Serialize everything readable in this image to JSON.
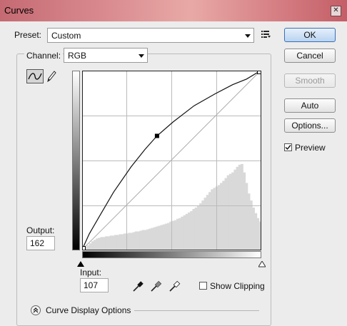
{
  "window": {
    "title": "Curves",
    "close_glyph": "✕"
  },
  "preset": {
    "label": "Preset:",
    "value": "Custom",
    "menu_icon": "preset-options-icon"
  },
  "channel": {
    "label": "Channel:",
    "value": "RGB"
  },
  "buttons": {
    "ok": "OK",
    "cancel": "Cancel",
    "smooth": "Smooth",
    "auto": "Auto",
    "options": "Options..."
  },
  "preview": {
    "label": "Preview",
    "checked": true
  },
  "tools": {
    "curve_tool": "curve-point-icon",
    "pencil_tool": "pencil-icon"
  },
  "output": {
    "label": "Output:",
    "value": "162"
  },
  "input": {
    "label": "Input:",
    "value": "107"
  },
  "eyedroppers": [
    "black-point-eyedropper-icon",
    "gray-point-eyedropper-icon",
    "white-point-eyedropper-icon"
  ],
  "show_clipping": {
    "label": "Show Clipping",
    "checked": false
  },
  "display_options": {
    "label": "Curve Display Options",
    "icon": "expand-chevron-icon"
  },
  "curve": {
    "points": [
      [
        0,
        0
      ],
      [
        107,
        162
      ],
      [
        255,
        255
      ]
    ],
    "path": [
      [
        0,
        0
      ],
      [
        10,
        22
      ],
      [
        25,
        48
      ],
      [
        45,
        82
      ],
      [
        70,
        118
      ],
      [
        90,
        143
      ],
      [
        107,
        162
      ],
      [
        130,
        182
      ],
      [
        160,
        205
      ],
      [
        190,
        222
      ],
      [
        215,
        235
      ],
      [
        235,
        243
      ],
      [
        255,
        255
      ]
    ],
    "histogram": [
      2,
      4,
      6,
      9,
      12,
      14,
      16,
      17,
      18,
      18,
      19,
      19,
      20,
      20,
      21,
      21,
      22,
      22,
      23,
      23,
      24,
      24,
      25,
      26,
      26,
      27,
      28,
      28,
      29,
      30,
      31,
      32,
      33,
      34,
      35,
      36,
      37,
      38,
      40,
      41,
      42,
      44,
      45,
      47,
      49,
      51,
      53,
      55,
      58,
      60,
      63,
      66,
      70,
      74,
      78,
      82,
      86,
      88,
      90,
      92,
      95,
      98,
      102,
      106,
      108,
      110,
      114,
      118,
      121,
      122,
      110,
      95,
      80,
      70,
      60,
      52,
      45,
      40
    ]
  }
}
